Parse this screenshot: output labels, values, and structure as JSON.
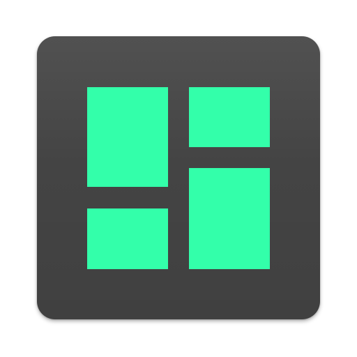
{
  "icon": {
    "name": "dashboard-grid-icon",
    "background_color": "#444444",
    "tile_color": "#33ffaa",
    "tiles": [
      {
        "id": "top-left",
        "shape": "tall"
      },
      {
        "id": "top-right",
        "shape": "short"
      },
      {
        "id": "bottom-left",
        "shape": "short"
      },
      {
        "id": "bottom-right",
        "shape": "tall"
      }
    ]
  }
}
